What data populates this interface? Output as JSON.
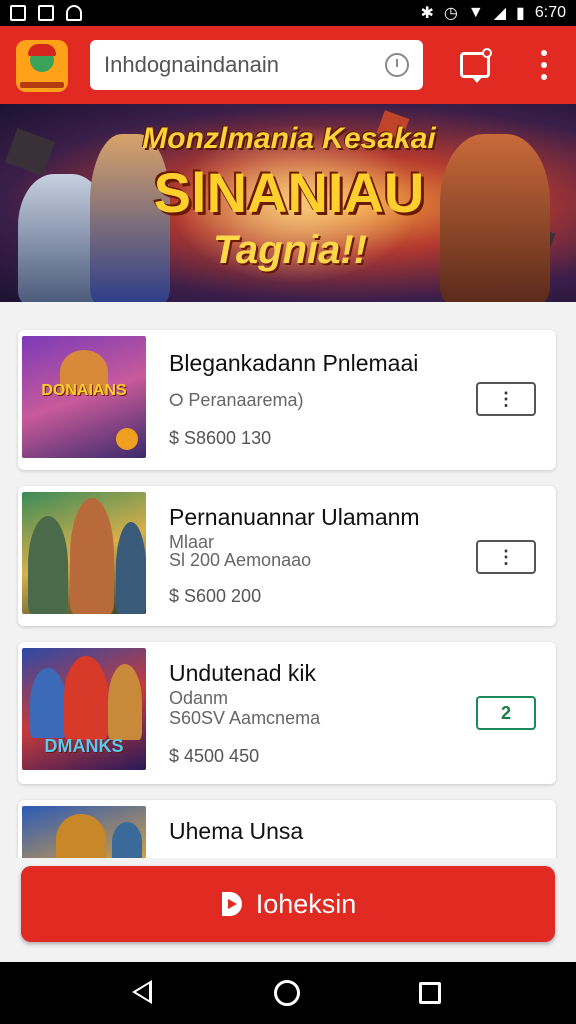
{
  "status_bar": {
    "time": "6:70",
    "icons": [
      "gallery-icon",
      "image-icon",
      "app-icon",
      "bluetooth-icon",
      "alarm-icon",
      "wifi-icon",
      "signal-icon",
      "battery-icon"
    ]
  },
  "app_bar": {
    "logo": "app-logo",
    "search_text": "Inhdognaindanain",
    "search_icon": "clock-icon",
    "chat_icon": "chat-icon",
    "menu_icon": "more-vert-icon",
    "color": "#e12a22"
  },
  "banner": {
    "line1": "Monzlmania Kesakai",
    "line2": "SlNANIAU",
    "line3": "Tagnia!!"
  },
  "games": [
    {
      "title": "Bleganka­dann Pnlemaai",
      "subtitle": "Peranaarema)",
      "subtitle_icon": "tag-icon",
      "price": "$  S8600 130",
      "action": "⋮",
      "thumb_title": "DONAIANS"
    },
    {
      "title": "Pernanuannar Ulamanm",
      "subtitle": "Mlaar",
      "subtitle2": "Sl 200 Aemonaao",
      "price": "$  S600 200",
      "action": "⋮",
      "thumb_title": ""
    },
    {
      "title": "Undutenad kik",
      "subtitle": "Odanm",
      "subtitle2": "S60SV Aamcnema",
      "price": "$  4500 450",
      "action": "2",
      "thumb_title": "DMANKS"
    },
    {
      "title": "Uhema Unsa",
      "subtitle": "",
      "price": "",
      "action": "",
      "thumb_title": ""
    }
  ],
  "cta": {
    "label": "Ioheksin",
    "icon": "play-logo-icon"
  },
  "nav": {
    "back": "back-icon",
    "home": "home-icon",
    "recent": "recent-apps-icon"
  }
}
